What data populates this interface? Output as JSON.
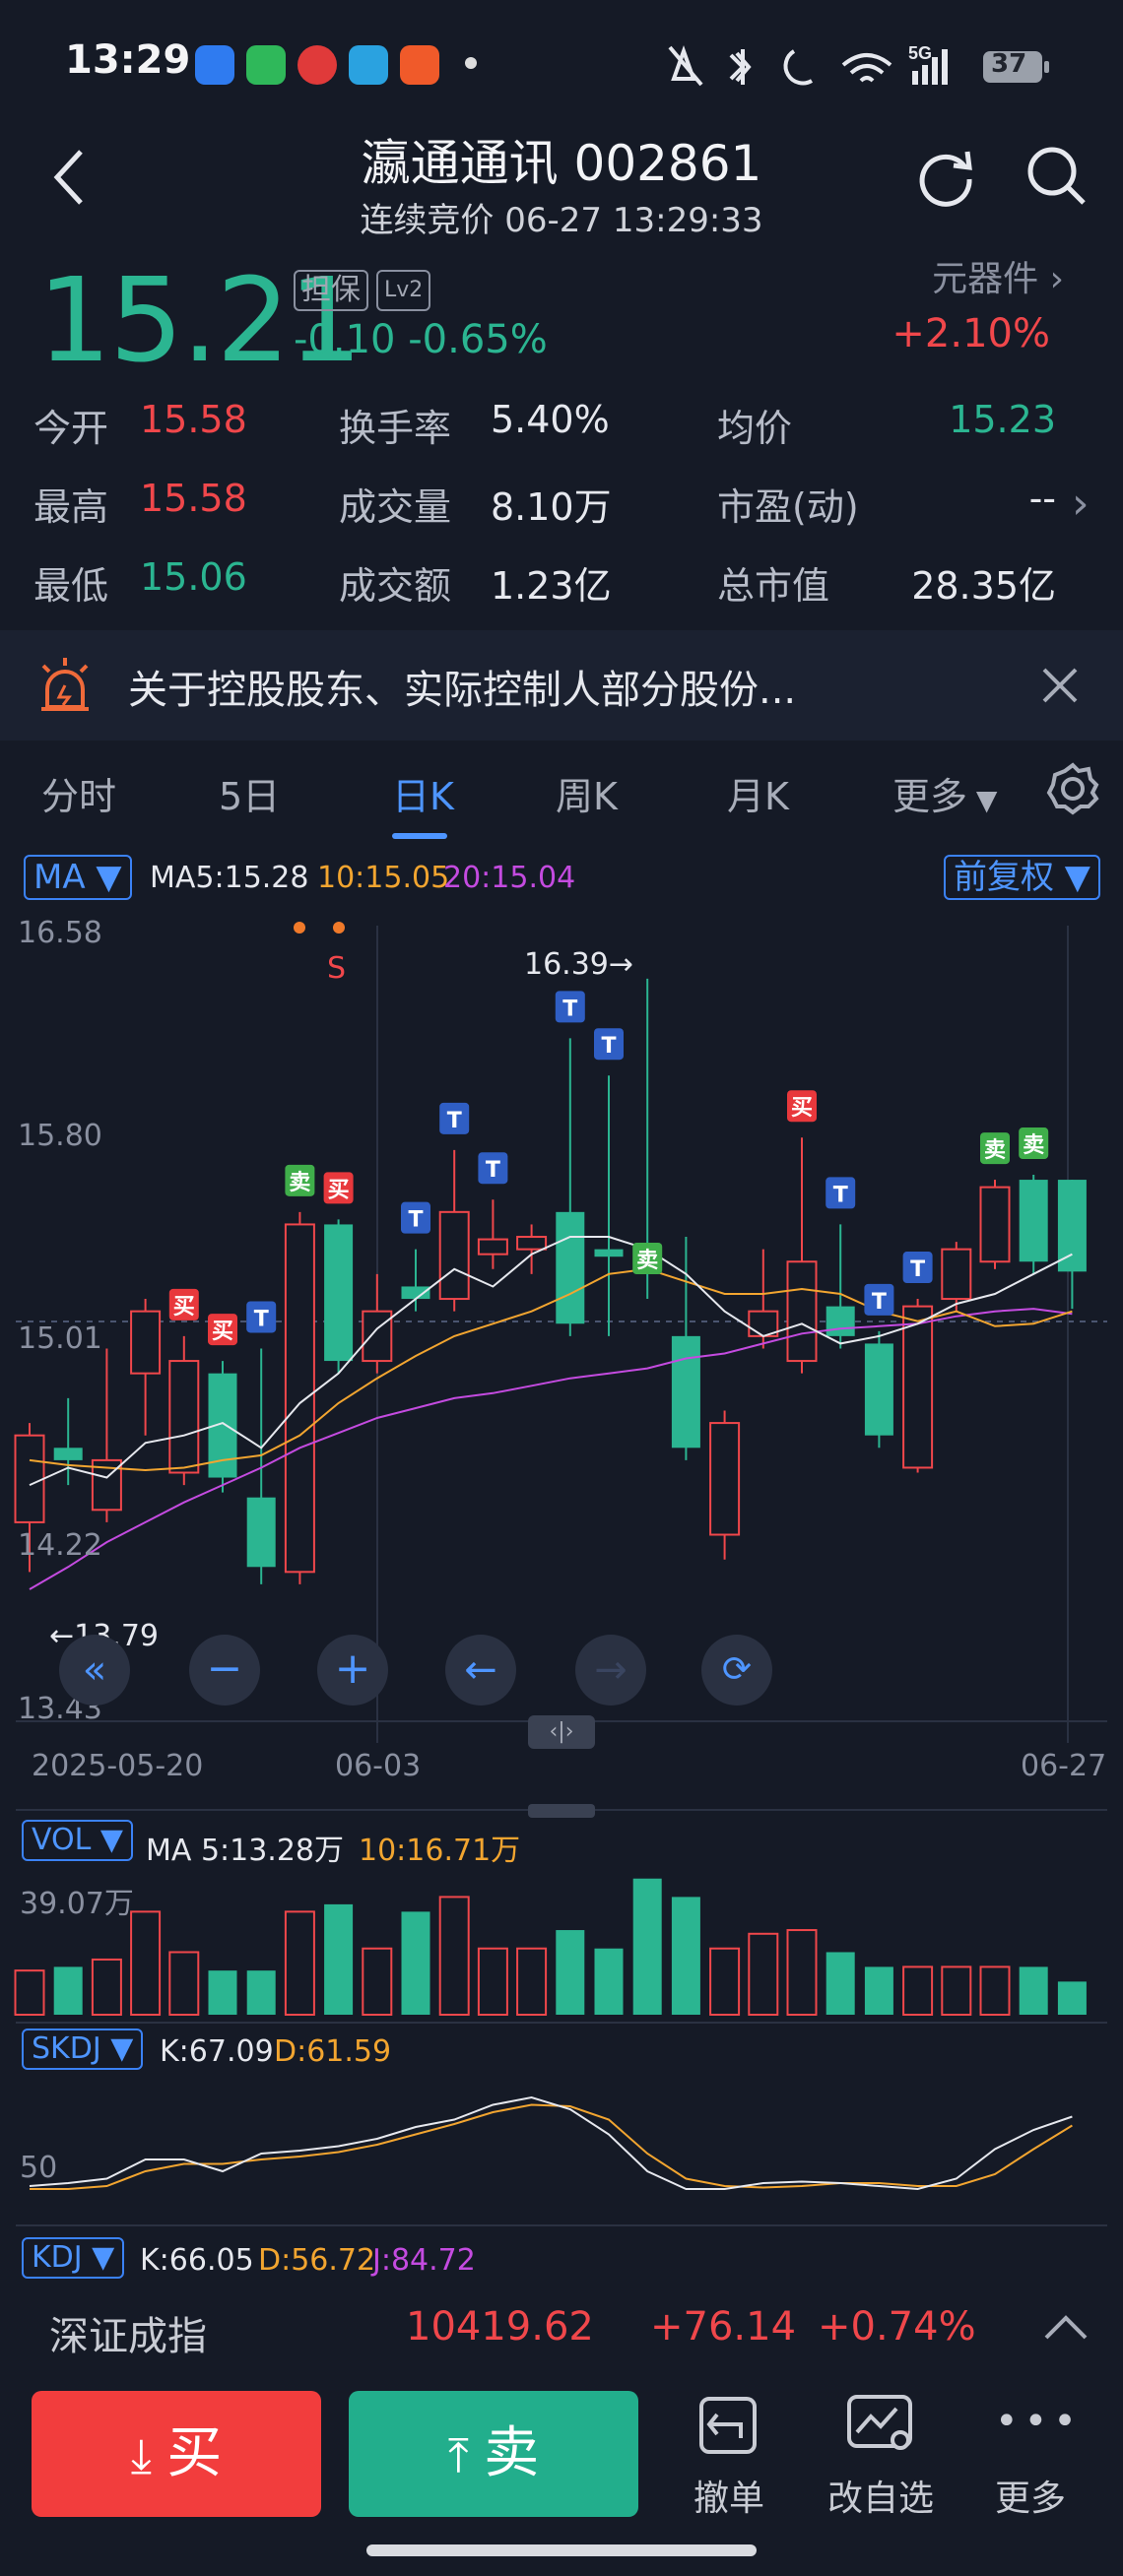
{
  "status_bar": {
    "time": "13:29",
    "network": "5G",
    "battery": "37"
  },
  "header": {
    "title": "瀛通通讯 002861",
    "subtitle": "连续竞价 06-27 13:29:33"
  },
  "quote": {
    "price": "15.21",
    "tag_margin": "担保",
    "tag_level": "Lv2",
    "change": "-0.10",
    "change_pct": "-0.65%",
    "industry": "元器件",
    "industry_pct": "+2.10%",
    "fields": [
      {
        "label": "今开",
        "value": "15.58",
        "color": "#f0474b"
      },
      {
        "label": "换手率",
        "value": "5.40%",
        "color": "#e6e8ee"
      },
      {
        "label": "均价",
        "value": "15.23",
        "color": "#2bb591"
      },
      {
        "label": "最高",
        "value": "15.58",
        "color": "#f0474b"
      },
      {
        "label": "成交量",
        "value": "8.10万",
        "color": "#e6e8ee"
      },
      {
        "label": "市盈(动)",
        "value": "--",
        "color": "#e6e8ee"
      },
      {
        "label": "最低",
        "value": "15.06",
        "color": "#2bb591"
      },
      {
        "label": "成交额",
        "value": "1.23亿",
        "color": "#e6e8ee"
      },
      {
        "label": "总市值",
        "value": "28.35亿",
        "color": "#e6e8ee"
      }
    ]
  },
  "notice": {
    "text": "关于控股股东、实际控制人部分股份..."
  },
  "tabs": [
    {
      "label": "分时"
    },
    {
      "label": "5日"
    },
    {
      "label": "日K"
    },
    {
      "label": "周K"
    },
    {
      "label": "月K"
    },
    {
      "label": "更多"
    }
  ],
  "active_tab": "日K",
  "ma_bar": {
    "selector": "MA",
    "ma5": "MA5:15.28",
    "ma10": "10:15.05",
    "ma20": "20:15.04",
    "adjust": "前复权"
  },
  "chart_labels": {
    "y_top": "16.58",
    "y_mid": "15.80",
    "y_low": "15.01",
    "y_bottom_mid": "14.22",
    "y_bottom": "13.43",
    "high_mark": "16.39→",
    "low_mark": "←13.79",
    "dates": [
      "2025-05-20",
      "06-03",
      "06-27"
    ],
    "signal_s": "S"
  },
  "vol_bar": {
    "selector": "VOL",
    "ma5": "MA 5:13.28万",
    "ma10": "10:16.71万",
    "y_top": "39.07万"
  },
  "skdj_bar": {
    "selector": "SKDJ",
    "k": "K:67.09",
    "d": "D:61.59",
    "y_mid": "50"
  },
  "kdj_bar": {
    "selector": "KDJ",
    "k": "K:66.05",
    "d": "D:56.72",
    "j": "J:84.72"
  },
  "index": {
    "name": "深证成指",
    "value": "10419.62",
    "change": "+76.14",
    "pct": "+0.74%"
  },
  "actions": {
    "buy": "买",
    "sell": "卖",
    "cancel": "撤单",
    "watchlist": "改自选",
    "more": "更多"
  },
  "chart_data": {
    "type": "candlestick",
    "x_labels": [
      "2025-05-20",
      "06-03",
      "06-27"
    ],
    "ylim": [
      13.43,
      16.58
    ],
    "candles": [
      {
        "o": 14.2,
        "c": 14.55,
        "h": 14.6,
        "l": 14.0,
        "dir": "up"
      },
      {
        "o": 14.5,
        "c": 14.45,
        "h": 14.7,
        "l": 14.35,
        "dir": "down"
      },
      {
        "o": 14.25,
        "c": 14.45,
        "h": 14.9,
        "l": 14.2,
        "dir": "up"
      },
      {
        "o": 14.8,
        "c": 15.05,
        "h": 15.1,
        "l": 14.55,
        "dir": "up"
      },
      {
        "o": 14.4,
        "c": 14.85,
        "h": 14.95,
        "l": 14.35,
        "dir": "up"
      },
      {
        "o": 14.8,
        "c": 14.38,
        "h": 14.85,
        "l": 14.32,
        "dir": "down"
      },
      {
        "o": 14.02,
        "c": 14.3,
        "h": 14.9,
        "l": 13.95,
        "dir": "down"
      },
      {
        "o": 14.0,
        "c": 15.4,
        "h": 15.45,
        "l": 13.95,
        "dir": "up"
      },
      {
        "o": 15.4,
        "c": 14.85,
        "h": 15.42,
        "l": 14.8,
        "dir": "down"
      },
      {
        "o": 14.85,
        "c": 15.05,
        "h": 15.2,
        "l": 14.8,
        "dir": "up"
      },
      {
        "o": 15.15,
        "c": 15.1,
        "h": 15.3,
        "l": 15.05,
        "dir": "down"
      },
      {
        "o": 15.1,
        "c": 15.45,
        "h": 15.7,
        "l": 15.05,
        "dir": "up"
      },
      {
        "o": 15.28,
        "c": 15.34,
        "h": 15.5,
        "l": 15.22,
        "dir": "up"
      },
      {
        "o": 15.35,
        "c": 15.3,
        "h": 15.4,
        "l": 15.2,
        "dir": "up"
      },
      {
        "o": 15.0,
        "c": 15.45,
        "h": 16.15,
        "l": 14.95,
        "dir": "down"
      },
      {
        "o": 15.27,
        "c": 15.3,
        "h": 16.0,
        "l": 14.95,
        "dir": "down"
      },
      {
        "o": 15.3,
        "c": 15.21,
        "h": 16.39,
        "l": 15.1,
        "dir": "down"
      },
      {
        "o": 14.95,
        "c": 14.5,
        "h": 15.35,
        "l": 14.45,
        "dir": "down"
      },
      {
        "o": 14.6,
        "c": 14.15,
        "h": 14.65,
        "l": 14.05,
        "dir": "up"
      },
      {
        "o": 14.95,
        "c": 15.05,
        "h": 15.3,
        "l": 14.9,
        "dir": "up"
      },
      {
        "o": 14.85,
        "c": 15.25,
        "h": 15.75,
        "l": 14.8,
        "dir": "up"
      },
      {
        "o": 15.07,
        "c": 14.95,
        "h": 15.4,
        "l": 14.9,
        "dir": "down"
      },
      {
        "o": 14.92,
        "c": 14.55,
        "h": 14.97,
        "l": 14.5,
        "dir": "down"
      },
      {
        "o": 14.42,
        "c": 15.07,
        "h": 15.1,
        "l": 14.4,
        "dir": "up"
      },
      {
        "o": 15.1,
        "c": 15.3,
        "h": 15.33,
        "l": 15.05,
        "dir": "up"
      },
      {
        "o": 15.25,
        "c": 15.55,
        "h": 15.58,
        "l": 15.22,
        "dir": "up"
      },
      {
        "o": 15.58,
        "c": 15.25,
        "h": 15.6,
        "l": 15.2,
        "dir": "down"
      },
      {
        "o": 15.58,
        "c": 15.21,
        "h": 15.58,
        "l": 15.06,
        "dir": "down"
      }
    ],
    "ma5": [
      14.35,
      14.42,
      14.38,
      14.52,
      14.55,
      14.6,
      14.5,
      14.68,
      14.8,
      14.98,
      15.1,
      15.22,
      15.15,
      15.28,
      15.35,
      15.35,
      15.3,
      15.2,
      15.05,
      14.95,
      15.0,
      14.92,
      14.95,
      15.0,
      15.08,
      15.12,
      15.2,
      15.28
    ],
    "ma10": [
      14.45,
      14.43,
      14.42,
      14.41,
      14.42,
      14.45,
      14.47,
      14.55,
      14.68,
      14.78,
      14.87,
      14.95,
      15.0,
      15.05,
      15.12,
      15.2,
      15.22,
      15.17,
      15.12,
      15.12,
      15.14,
      15.12,
      15.05,
      15.01,
      15.05,
      14.99,
      15.0,
      15.05
    ],
    "ma20": [
      13.93,
      14.02,
      14.12,
      14.2,
      14.28,
      14.35,
      14.42,
      14.5,
      14.56,
      14.62,
      14.66,
      14.7,
      14.72,
      14.75,
      14.78,
      14.8,
      14.82,
      14.86,
      14.88,
      14.92,
      14.96,
      14.98,
      14.99,
      15.0,
      15.03,
      15.05,
      15.06,
      15.04
    ],
    "markers": [
      {
        "i": 4,
        "text": "买",
        "kind": "buy",
        "at": "high"
      },
      {
        "i": 5,
        "text": "买",
        "kind": "buy",
        "at": "high"
      },
      {
        "i": 6,
        "text": "T",
        "kind": "t",
        "at": "high"
      },
      {
        "i": 7,
        "text": "卖",
        "kind": "sell",
        "at": "high"
      },
      {
        "i": 8,
        "text": "买",
        "kind": "buy",
        "at": "high"
      },
      {
        "i": 10,
        "text": "T",
        "kind": "t",
        "at": "high"
      },
      {
        "i": 11,
        "text": "T",
        "kind": "t",
        "at": "high"
      },
      {
        "i": 12,
        "text": "T",
        "kind": "t",
        "at": "high"
      },
      {
        "i": 14,
        "text": "T",
        "kind": "t",
        "at": "high"
      },
      {
        "i": 15,
        "text": "T",
        "kind": "t",
        "at": "high"
      },
      {
        "i": 16,
        "text": "卖",
        "kind": "sell",
        "at": "mid"
      },
      {
        "i": 20,
        "text": "买",
        "kind": "buy",
        "at": "high"
      },
      {
        "i": 21,
        "text": "T",
        "kind": "t",
        "at": "high"
      },
      {
        "i": 22,
        "text": "T",
        "kind": "t",
        "at": "high"
      },
      {
        "i": 23,
        "text": "T",
        "kind": "t",
        "at": "high"
      },
      {
        "i": 25,
        "text": "卖",
        "kind": "sell",
        "at": "high"
      },
      {
        "i": 26,
        "text": "卖",
        "kind": "sell",
        "at": "high"
      }
    ],
    "volume": [
      12,
      13,
      15,
      28,
      17,
      12,
      12,
      28,
      30,
      18,
      28,
      32,
      18,
      18,
      23,
      18,
      37,
      32,
      18,
      22,
      23,
      17,
      13,
      13,
      13,
      13,
      13,
      9
    ],
    "volume_max": 39.07,
    "skdj_k": [
      20,
      22,
      25,
      38,
      38,
      30,
      42,
      44,
      47,
      52,
      60,
      65,
      75,
      80,
      72,
      55,
      30,
      18,
      18,
      22,
      23,
      22,
      20,
      18,
      25,
      45,
      58,
      67
    ],
    "skdj_d": [
      18,
      18,
      20,
      30,
      35,
      35,
      38,
      40,
      43,
      48,
      55,
      62,
      70,
      75,
      74,
      65,
      42,
      25,
      20,
      19,
      20,
      22,
      22,
      20,
      20,
      28,
      45,
      61
    ]
  }
}
